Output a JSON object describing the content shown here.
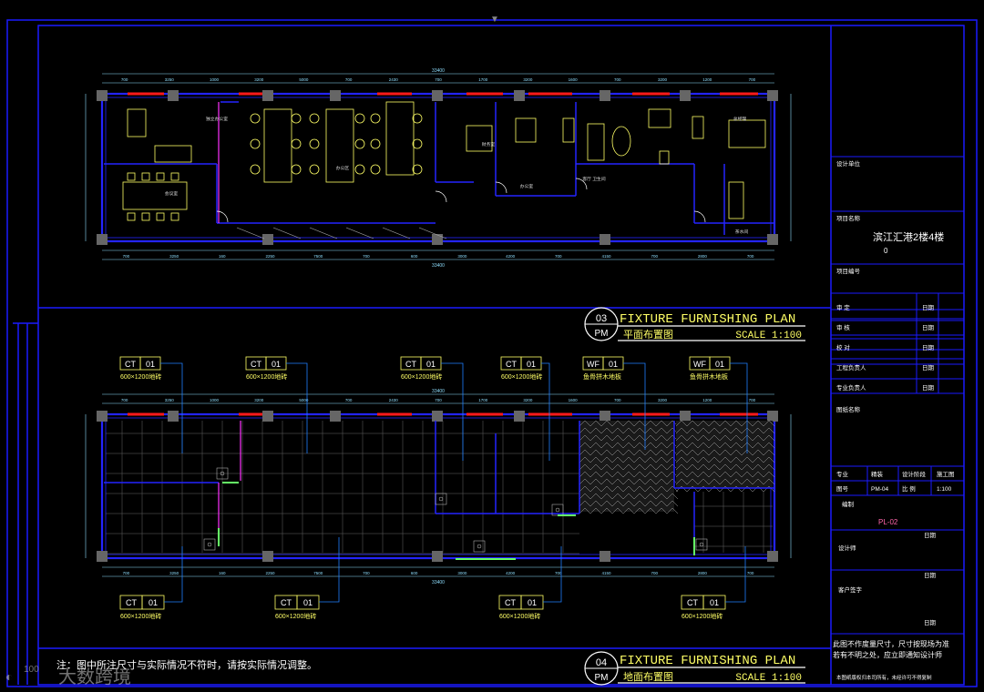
{
  "plan_top": {
    "number": "03",
    "code": "PM",
    "title_en": "FIXTURE FURNISHING PLAN",
    "title_cn": "平面布置图",
    "scale": "SCALE 1:100",
    "overall_dim": "33400",
    "top_dims": [
      "700",
      "3250",
      "1000",
      "3200",
      "5000",
      "700",
      "2430",
      "700",
      "1700",
      "3200",
      "1600",
      "700",
      "3200",
      "1200",
      "700"
    ],
    "bottom_dims": [
      "700",
      "3250",
      "160",
      "2250",
      "7500",
      "700",
      "600",
      "3000",
      "4200",
      "700",
      "4150",
      "700",
      "2800",
      "700"
    ],
    "rooms": [
      "独立办公室",
      "办公区",
      "会议室",
      "财务室",
      "办公室",
      "客厅 卫生间",
      "总经理",
      "茶水间"
    ]
  },
  "plan_bottom": {
    "number": "04",
    "code": "PM",
    "title_en": "FIXTURE FURNISHING PLAN",
    "title_cn": "地面布置图",
    "scale": "SCALE 1:100",
    "overall_dim": "33400"
  },
  "tags_top": [
    {
      "code": "CT",
      "num": "01",
      "desc": "600×1200地砖"
    },
    {
      "code": "CT",
      "num": "01",
      "desc": "600×1200地砖"
    },
    {
      "code": "CT",
      "num": "01",
      "desc": "600×1200地砖"
    },
    {
      "code": "CT",
      "num": "01",
      "desc": "600×1200地砖"
    },
    {
      "code": "WF",
      "num": "01",
      "desc": "鱼骨拼木地板"
    },
    {
      "code": "WF",
      "num": "01",
      "desc": "鱼骨拼木地板"
    }
  ],
  "tags_bottom": [
    {
      "code": "CT",
      "num": "01",
      "desc": "600×1200地砖"
    },
    {
      "code": "CT",
      "num": "01",
      "desc": "600×1200地砖"
    },
    {
      "code": "CT",
      "num": "01",
      "desc": "600×1200地砖"
    },
    {
      "code": "CT",
      "num": "01",
      "desc": "600×1200地砖"
    }
  ],
  "note": "注：图中所注尺寸与实际情况不符时，请按实际情况调整。",
  "watermark": "大数跨境",
  "title_block": {
    "design_unit": "设计单位",
    "project_name_label": "项目名称",
    "project_name": "滨江汇港2楼4楼",
    "project_sub": "0",
    "project_no_label": "项目编号",
    "sign_rows": [
      {
        "label": "审  定",
        "date": "日期"
      },
      {
        "label": "审  核",
        "date": "日期"
      },
      {
        "label": "校  对",
        "date": "日期"
      },
      {
        "label": "工程负责人",
        "date": "日期"
      },
      {
        "label": "专业负责人",
        "date": "日期"
      }
    ],
    "drawing_name_label": "图纸名称",
    "meta": {
      "major_label": "专业",
      "major": "精装",
      "stage_label": "设计阶段",
      "stage": "施工图",
      "drawing_no_label": "图号",
      "drawing_no": "PM-04",
      "scale_label": "比  例",
      "scale": "1:100"
    },
    "sheet_label": "编制",
    "sheet_code": "PL-02",
    "date_label": "日期",
    "designer_label": "设计师",
    "client_label": "客户签字",
    "disclaimer": "此图不作度量尺寸，尺寸按现场为准若有不明之处，应立即通知设计师",
    "footer": "本图纸版权归本司所有，未经许可不得复制"
  },
  "colors": {
    "frame": "#1a1aff",
    "wall": "#2424ff",
    "furniture": "#ffff66",
    "window": "#ff1a1a",
    "door": "#ffffff",
    "dim": "#8fdfff",
    "column": "#666666",
    "magenta": "#ff33ff",
    "green": "#66ff66"
  }
}
